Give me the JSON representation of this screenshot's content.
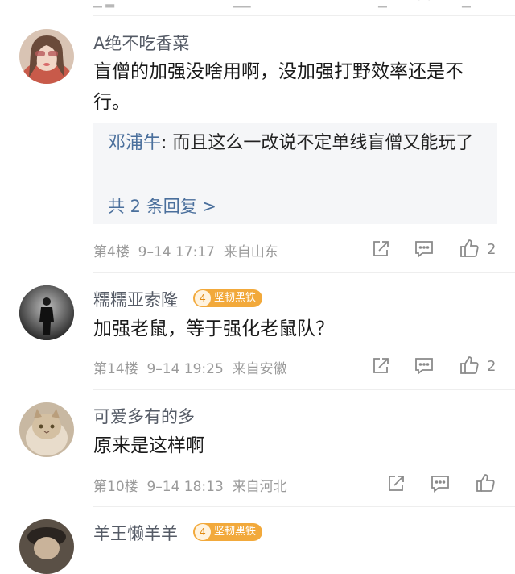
{
  "comments": [
    {
      "username": "A绝不吃香菜",
      "text": "盲僧的加强没啥用啊，没加强打野效率还是不行。",
      "reply": {
        "author": "邓浦牛",
        "text": ": 而且这么一改说不定单线盲僧又能玩了",
        "more": "共 2 条回复 >"
      },
      "floor": "第4楼",
      "time": "9–14 17:17",
      "location": "来自山东",
      "likes": "2"
    },
    {
      "username": "糯糯亚索隆",
      "badge": {
        "level": "4",
        "label": "坚韧黑铁"
      },
      "text": "加强老鼠，等于强化老鼠队？",
      "floor": "第14楼",
      "time": "9–14 19:25",
      "location": "来自安徽",
      "likes": "2"
    },
    {
      "username": "可爱多有的多",
      "text": "原来是这样啊",
      "floor": "第10楼",
      "time": "9–14 18:13",
      "location": "来自河北",
      "likes": ""
    },
    {
      "username": "羊王懒羊羊",
      "badge": {
        "level": "4",
        "label": "坚韧黑铁"
      }
    }
  ],
  "icons": {
    "share": "share-icon",
    "comment": "comment-icon",
    "like": "thumbs-up-icon"
  },
  "colors": {
    "username": "#555b66",
    "reply_link": "#4a6f9c",
    "meta": "#9a9a9a",
    "badge": "#f2a93b"
  }
}
